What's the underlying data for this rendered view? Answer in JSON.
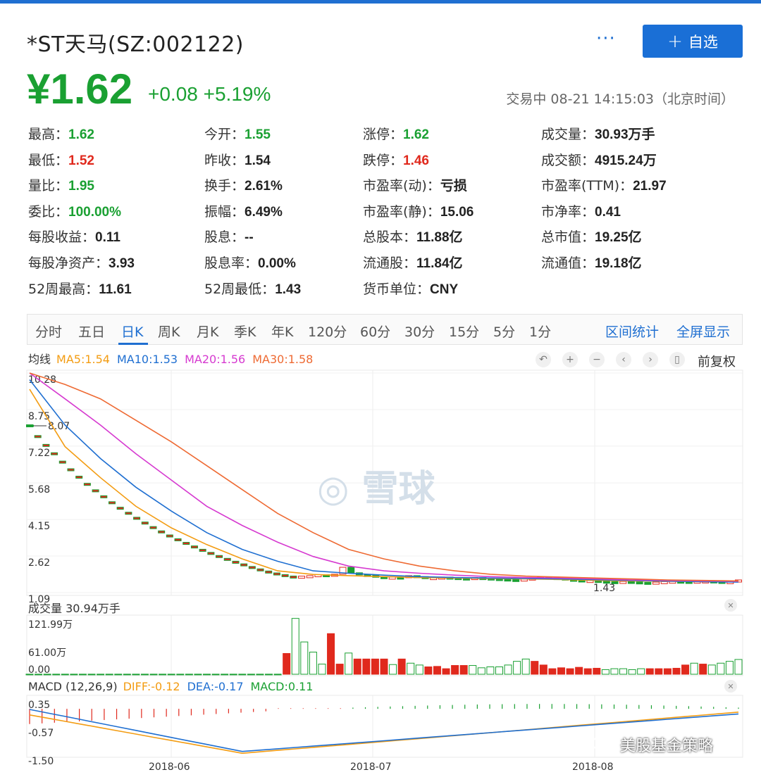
{
  "header": {
    "title": "*ST天马(SZ:002122)",
    "more_label": "···",
    "add_label": "自选",
    "price": "¥1.62",
    "change": "+0.08 +5.19%",
    "status": "交易中 08-21 14:15:03（北京时间）"
  },
  "stats": [
    [
      {
        "k": "最高：",
        "v": "1.62",
        "c": "green"
      },
      {
        "k": "今开：",
        "v": "1.55",
        "c": "green"
      },
      {
        "k": "涨停：",
        "v": "1.62",
        "c": "green"
      },
      {
        "k": "成交量：",
        "v": "30.93万手",
        "c": "dark"
      }
    ],
    [
      {
        "k": "最低：",
        "v": "1.52",
        "c": "red"
      },
      {
        "k": "昨收：",
        "v": "1.54",
        "c": "dark"
      },
      {
        "k": "跌停：",
        "v": "1.46",
        "c": "red"
      },
      {
        "k": "成交额：",
        "v": "4915.24万",
        "c": "dark"
      }
    ],
    [
      {
        "k": "量比：",
        "v": "1.95",
        "c": "green"
      },
      {
        "k": "换手：",
        "v": "2.61%",
        "c": "dark"
      },
      {
        "k": "市盈率(动)：",
        "v": "亏损",
        "c": "dark"
      },
      {
        "k": "市盈率(TTM)：",
        "v": "21.97",
        "c": "dark"
      }
    ],
    [
      {
        "k": "委比：",
        "v": "100.00%",
        "c": "green"
      },
      {
        "k": "振幅：",
        "v": "6.49%",
        "c": "dark"
      },
      {
        "k": "市盈率(静)：",
        "v": "15.06",
        "c": "dark"
      },
      {
        "k": "市净率：",
        "v": "0.41",
        "c": "dark"
      }
    ],
    [
      {
        "k": "每股收益：",
        "v": "0.11",
        "c": "dark"
      },
      {
        "k": "股息：",
        "v": "--",
        "c": "dark"
      },
      {
        "k": "总股本：",
        "v": "11.88亿",
        "c": "dark"
      },
      {
        "k": "总市值：",
        "v": "19.25亿",
        "c": "dark"
      }
    ],
    [
      {
        "k": "每股净资产：",
        "v": "3.93",
        "c": "dark"
      },
      {
        "k": "股息率：",
        "v": "0.00%",
        "c": "dark"
      },
      {
        "k": "流通股：",
        "v": "11.84亿",
        "c": "dark"
      },
      {
        "k": "流通值：",
        "v": "19.18亿",
        "c": "dark"
      }
    ],
    [
      {
        "k": "52周最高：",
        "v": "11.61",
        "c": "dark"
      },
      {
        "k": "52周最低：",
        "v": "1.43",
        "c": "dark"
      },
      {
        "k": "货币单位：",
        "v": "CNY",
        "c": "dark"
      }
    ]
  ],
  "tabs": [
    "分时",
    "五日",
    "日K",
    "周K",
    "月K",
    "季K",
    "年K",
    "120分",
    "60分",
    "30分",
    "15分",
    "5分",
    "1分"
  ],
  "active_tab": "日K",
  "tab_links": [
    "区间统计",
    "全屏显示"
  ],
  "ma_legend": {
    "label": "均线",
    "items": [
      {
        "text": "MA5:1.54",
        "color": "#f39c12"
      },
      {
        "text": "MA10:1.53",
        "color": "#1f6fd1"
      },
      {
        "text": "MA20:1.56",
        "color": "#d63ad0"
      },
      {
        "text": "MA30:1.58",
        "color": "#ee6a33"
      }
    ]
  },
  "fuquan_label": "前复权",
  "volume_legend": "成交量 30.94万手",
  "macd_legend": {
    "label": "MACD (12,26,9)",
    "items": [
      {
        "text": "DIFF:-0.12",
        "color": "#f39c12"
      },
      {
        "text": "DEA:-0.17",
        "color": "#1f6fd1"
      },
      {
        "text": "MACD:0.11",
        "color": "#1aa032"
      }
    ]
  },
  "watermark_logo": "雪球",
  "watermark_text": "美股基金策略",
  "colors": {
    "up": "#e0291d",
    "down": "#1aa032",
    "accent": "#1f6fd1"
  },
  "chart_data": {
    "type": "candlestick",
    "x_dates": [
      "2018-06",
      "2018-07",
      "2018-08"
    ],
    "price_ticks": [
      "10.28",
      "8.75",
      "7.22",
      "5.68",
      "4.15",
      "2.62",
      "1.09"
    ],
    "price_ylim": [
      1.09,
      10.28
    ],
    "max_label": "8.07",
    "min_label": "1.43",
    "closes": [
      8.07,
      7.62,
      7.25,
      6.9,
      6.55,
      6.23,
      5.92,
      5.62,
      5.35,
      5.1,
      4.85,
      4.62,
      4.41,
      4.2,
      4.0,
      3.81,
      3.63,
      3.46,
      3.3,
      3.15,
      3.0,
      2.86,
      2.73,
      2.6,
      2.48,
      2.36,
      2.25,
      2.14,
      2.04,
      1.95,
      1.87,
      1.8,
      1.74,
      1.78,
      1.8,
      1.84,
      1.82,
      1.86,
      2.15,
      1.92,
      1.85,
      1.82,
      1.76,
      1.7,
      1.74,
      1.72,
      1.8,
      1.76,
      1.7,
      1.72,
      1.74,
      1.72,
      1.7,
      1.68,
      1.72,
      1.7,
      1.68,
      1.66,
      1.64,
      1.62,
      1.66,
      1.7,
      1.74,
      1.72,
      1.7,
      1.65,
      1.62,
      1.58,
      1.6,
      1.57,
      1.55,
      1.53,
      1.56,
      1.54,
      1.52,
      1.5,
      1.53,
      1.55,
      1.57,
      1.56,
      1.55,
      1.57,
      1.58,
      1.56,
      1.54,
      1.55,
      1.62
    ],
    "ma": {
      "MA5": [
        9.6,
        7.2,
        5.9,
        4.7,
        3.8,
        3.1,
        2.5,
        2.0,
        1.85,
        1.8,
        1.76,
        1.72,
        1.7,
        1.68,
        1.66,
        1.64,
        1.6,
        1.58,
        1.56,
        1.55,
        1.54
      ],
      "MA10": [
        10.0,
        8.1,
        6.7,
        5.5,
        4.5,
        3.6,
        2.9,
        2.4,
        2.0,
        1.9,
        1.82,
        1.76,
        1.72,
        1.7,
        1.68,
        1.66,
        1.63,
        1.6,
        1.57,
        1.55,
        1.53
      ],
      "MA20": [
        10.28,
        9.2,
        8.1,
        6.9,
        5.8,
        4.7,
        3.9,
        3.2,
        2.6,
        2.2,
        2.0,
        1.9,
        1.82,
        1.76,
        1.72,
        1.7,
        1.66,
        1.62,
        1.6,
        1.58,
        1.56
      ],
      "MA30": [
        10.28,
        9.8,
        9.2,
        8.3,
        7.4,
        6.4,
        5.4,
        4.4,
        3.6,
        2.9,
        2.5,
        2.2,
        2.0,
        1.86,
        1.78,
        1.74,
        1.7,
        1.66,
        1.62,
        1.6,
        1.58
      ]
    },
    "volume_ticks": [
      "121.99万",
      "61.00万",
      "0.00"
    ],
    "volume_ylim": [
      0,
      121.99
    ],
    "volumes": [
      0.2,
      0.2,
      0.2,
      0.2,
      0.2,
      0.2,
      0.2,
      0.2,
      0.2,
      0.2,
      0.2,
      0.2,
      0.2,
      0.2,
      0.2,
      0.2,
      0.2,
      0.2,
      0.2,
      0.2,
      0.2,
      0.2,
      0.2,
      0.2,
      0.2,
      0.2,
      0.2,
      0.2,
      0.2,
      45,
      121,
      70,
      48,
      22,
      88,
      22,
      46,
      33,
      33,
      33,
      33,
      21,
      33,
      24,
      20,
      16,
      17,
      12,
      19,
      19,
      19,
      14,
      16,
      16,
      20,
      28,
      33,
      28,
      20,
      12,
      14,
      12,
      15,
      12,
      13,
      10,
      12,
      12,
      10,
      12,
      12,
      12,
      12,
      13,
      20,
      24,
      22,
      20,
      24,
      28,
      32
    ],
    "volume_up": [
      false,
      false,
      false,
      false,
      false,
      false,
      false,
      false,
      false,
      false,
      false,
      false,
      false,
      false,
      false,
      false,
      false,
      false,
      false,
      false,
      false,
      false,
      false,
      false,
      false,
      false,
      false,
      false,
      false,
      true,
      false,
      false,
      false,
      false,
      true,
      true,
      false,
      true,
      true,
      true,
      true,
      false,
      true,
      false,
      false,
      true,
      true,
      true,
      true,
      true,
      false,
      false,
      false,
      false,
      false,
      false,
      false,
      true,
      true,
      true,
      true,
      true,
      true,
      true,
      true,
      false,
      false,
      false,
      false,
      false,
      true,
      true,
      true,
      true,
      true,
      false,
      true,
      false,
      false,
      false,
      false
    ],
    "macd_ticks": [
      "0.35",
      "-0.57",
      "-1.50"
    ],
    "macd_ylim": [
      -1.5,
      0.35
    ]
  }
}
